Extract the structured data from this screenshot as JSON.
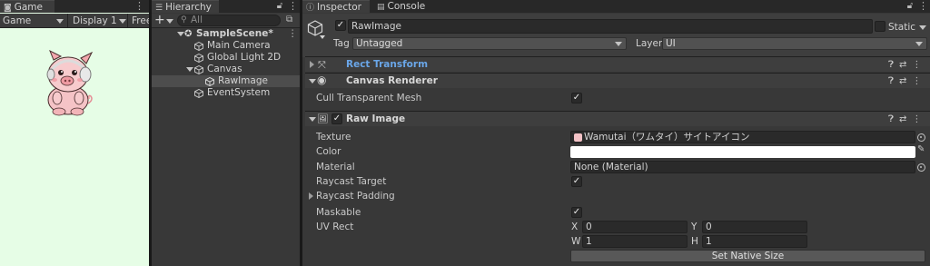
{
  "game_panel": {
    "tab_label": "Game",
    "display_mode": "Game",
    "display": "Display 1",
    "aspect": "Free",
    "background": "#e6fde6"
  },
  "hierarchy_panel": {
    "tab_label": "Hierarchy",
    "search_placeholder": "All",
    "items": [
      {
        "label": "SampleScene*"
      },
      {
        "label": "Main Camera"
      },
      {
        "label": "Global Light 2D"
      },
      {
        "label": "Canvas"
      },
      {
        "label": "RawImage"
      },
      {
        "label": "EventSystem"
      }
    ]
  },
  "inspector_panel": {
    "tab_label": "Inspector",
    "console_tab_label": "Console",
    "object": {
      "name": "RawImage",
      "active": true,
      "static_label": "Static",
      "tag_label": "Tag",
      "tag_value": "Untagged",
      "layer_label": "Layer",
      "layer_value": "UI"
    },
    "components": {
      "rect_transform": {
        "title": "Rect Transform"
      },
      "canvas_renderer": {
        "title": "Canvas Renderer",
        "cull_label": "Cull Transparent Mesh",
        "cull_value": true
      },
      "raw_image": {
        "title": "Raw Image",
        "texture_label": "Texture",
        "texture_value": "Wamutai（ワムタイ）サイトアイコン",
        "color_label": "Color",
        "color_value": "#ffffff",
        "material_label": "Material",
        "material_value": "None (Material)",
        "raycast_target_label": "Raycast Target",
        "raycast_target_value": true,
        "raycast_padding_label": "Raycast Padding",
        "maskable_label": "Maskable",
        "maskable_value": true,
        "uv_rect_label": "UV Rect",
        "uv": {
          "x_label": "X",
          "x": "0",
          "y_label": "Y",
          "y": "0",
          "w_label": "W",
          "w": "1",
          "h_label": "H",
          "h": "1"
        },
        "native_size_button": "Set Native Size"
      }
    }
  }
}
